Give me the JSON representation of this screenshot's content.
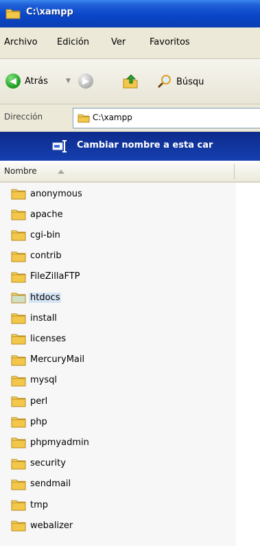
{
  "window": {
    "title": "C:\\xampp",
    "icon": "folder-icon"
  },
  "menu": [
    "Archivo",
    "Edición",
    "Ver",
    "Favoritos"
  ],
  "toolbar": {
    "back_label": "Atrás",
    "search_label": "Búsqu"
  },
  "address": {
    "label": "Dirección",
    "path": "C:\\xampp"
  },
  "task": {
    "label": "Cambiar nombre a esta car"
  },
  "list": {
    "column_header": "Nombre",
    "sort": "ascending",
    "selected": "htdocs",
    "items": [
      "anonymous",
      "apache",
      "cgi-bin",
      "contrib",
      "FileZillaFTP",
      "htdocs",
      "install",
      "licenses",
      "MercuryMail",
      "mysql",
      "perl",
      "php",
      "phpmyadmin",
      "security",
      "sendmail",
      "tmp",
      "webalizer"
    ]
  },
  "colors": {
    "title_bar": "#0a46c8",
    "menu_bg": "#ece9d8",
    "task_banner": "#1540b0",
    "selection": "#d6e5f5",
    "folder": "#f3c74a"
  }
}
